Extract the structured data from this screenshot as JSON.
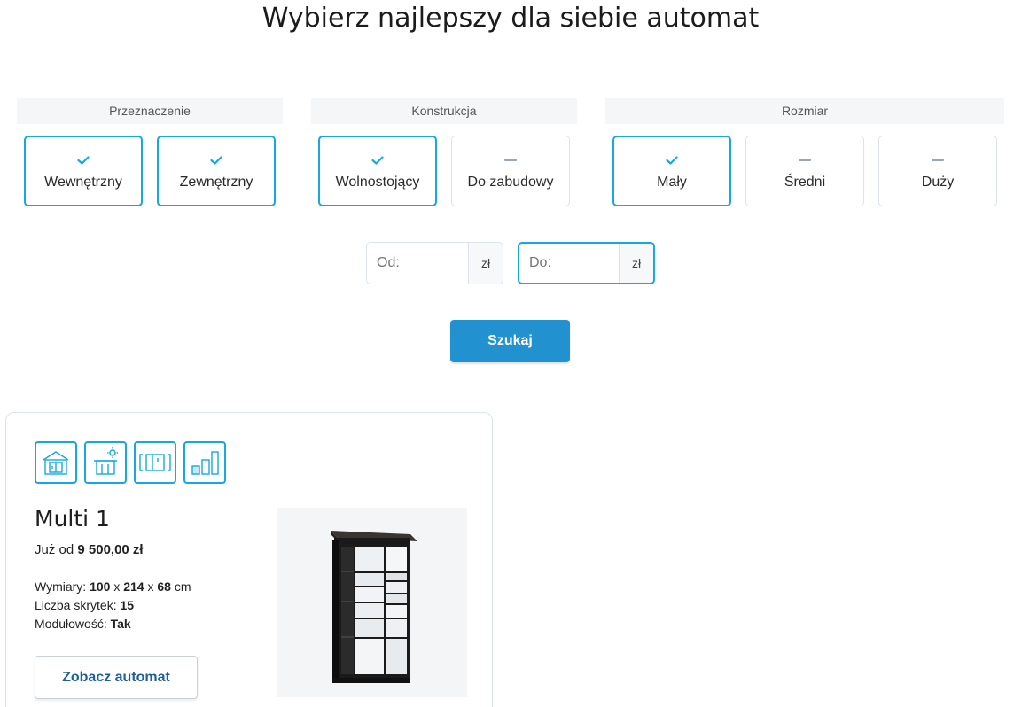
{
  "page": {
    "title": "Wybierz najlepszy dla siebie automat"
  },
  "filters": [
    {
      "header": "Przeznaczenie",
      "options": [
        {
          "label": "Wewnętrzny",
          "checked": true
        },
        {
          "label": "Zewnętrzny",
          "checked": true
        }
      ]
    },
    {
      "header": "Konstrukcja",
      "options": [
        {
          "label": "Wolnostojący",
          "checked": true
        },
        {
          "label": "Do zabudowy",
          "checked": false
        }
      ]
    },
    {
      "header": "Rozmiar",
      "options": [
        {
          "label": "Mały",
          "checked": true
        },
        {
          "label": "Średni",
          "checked": false
        },
        {
          "label": "Duży",
          "checked": false
        }
      ]
    }
  ],
  "price": {
    "from": {
      "placeholder": "Od:",
      "value": "",
      "unit": "zł"
    },
    "to": {
      "placeholder": "Do:",
      "value": "",
      "unit": "zł"
    }
  },
  "search_button": "Szukaj",
  "colors": {
    "accent": "#17a8df",
    "button": "#2291cf",
    "link": "#1f5f9c"
  },
  "product": {
    "feature_icons": [
      "indoor-building-icon",
      "outdoor-sun-icon",
      "freestanding-module-icon",
      "size-bars-icon"
    ],
    "name": "Multi 1",
    "price_prefix": "Już od",
    "price": "9 500,00 zł",
    "dimensions_label": "Wymiary:",
    "dim_w": "100",
    "dim_h": "214",
    "dim_d": "68",
    "dim_unit": "cm",
    "dim_sep": "x",
    "lockers_label": "Liczba skrytek:",
    "lockers": "15",
    "modular_label": "Modułowość:",
    "modular": "Tak",
    "button": "Zobacz automat"
  }
}
